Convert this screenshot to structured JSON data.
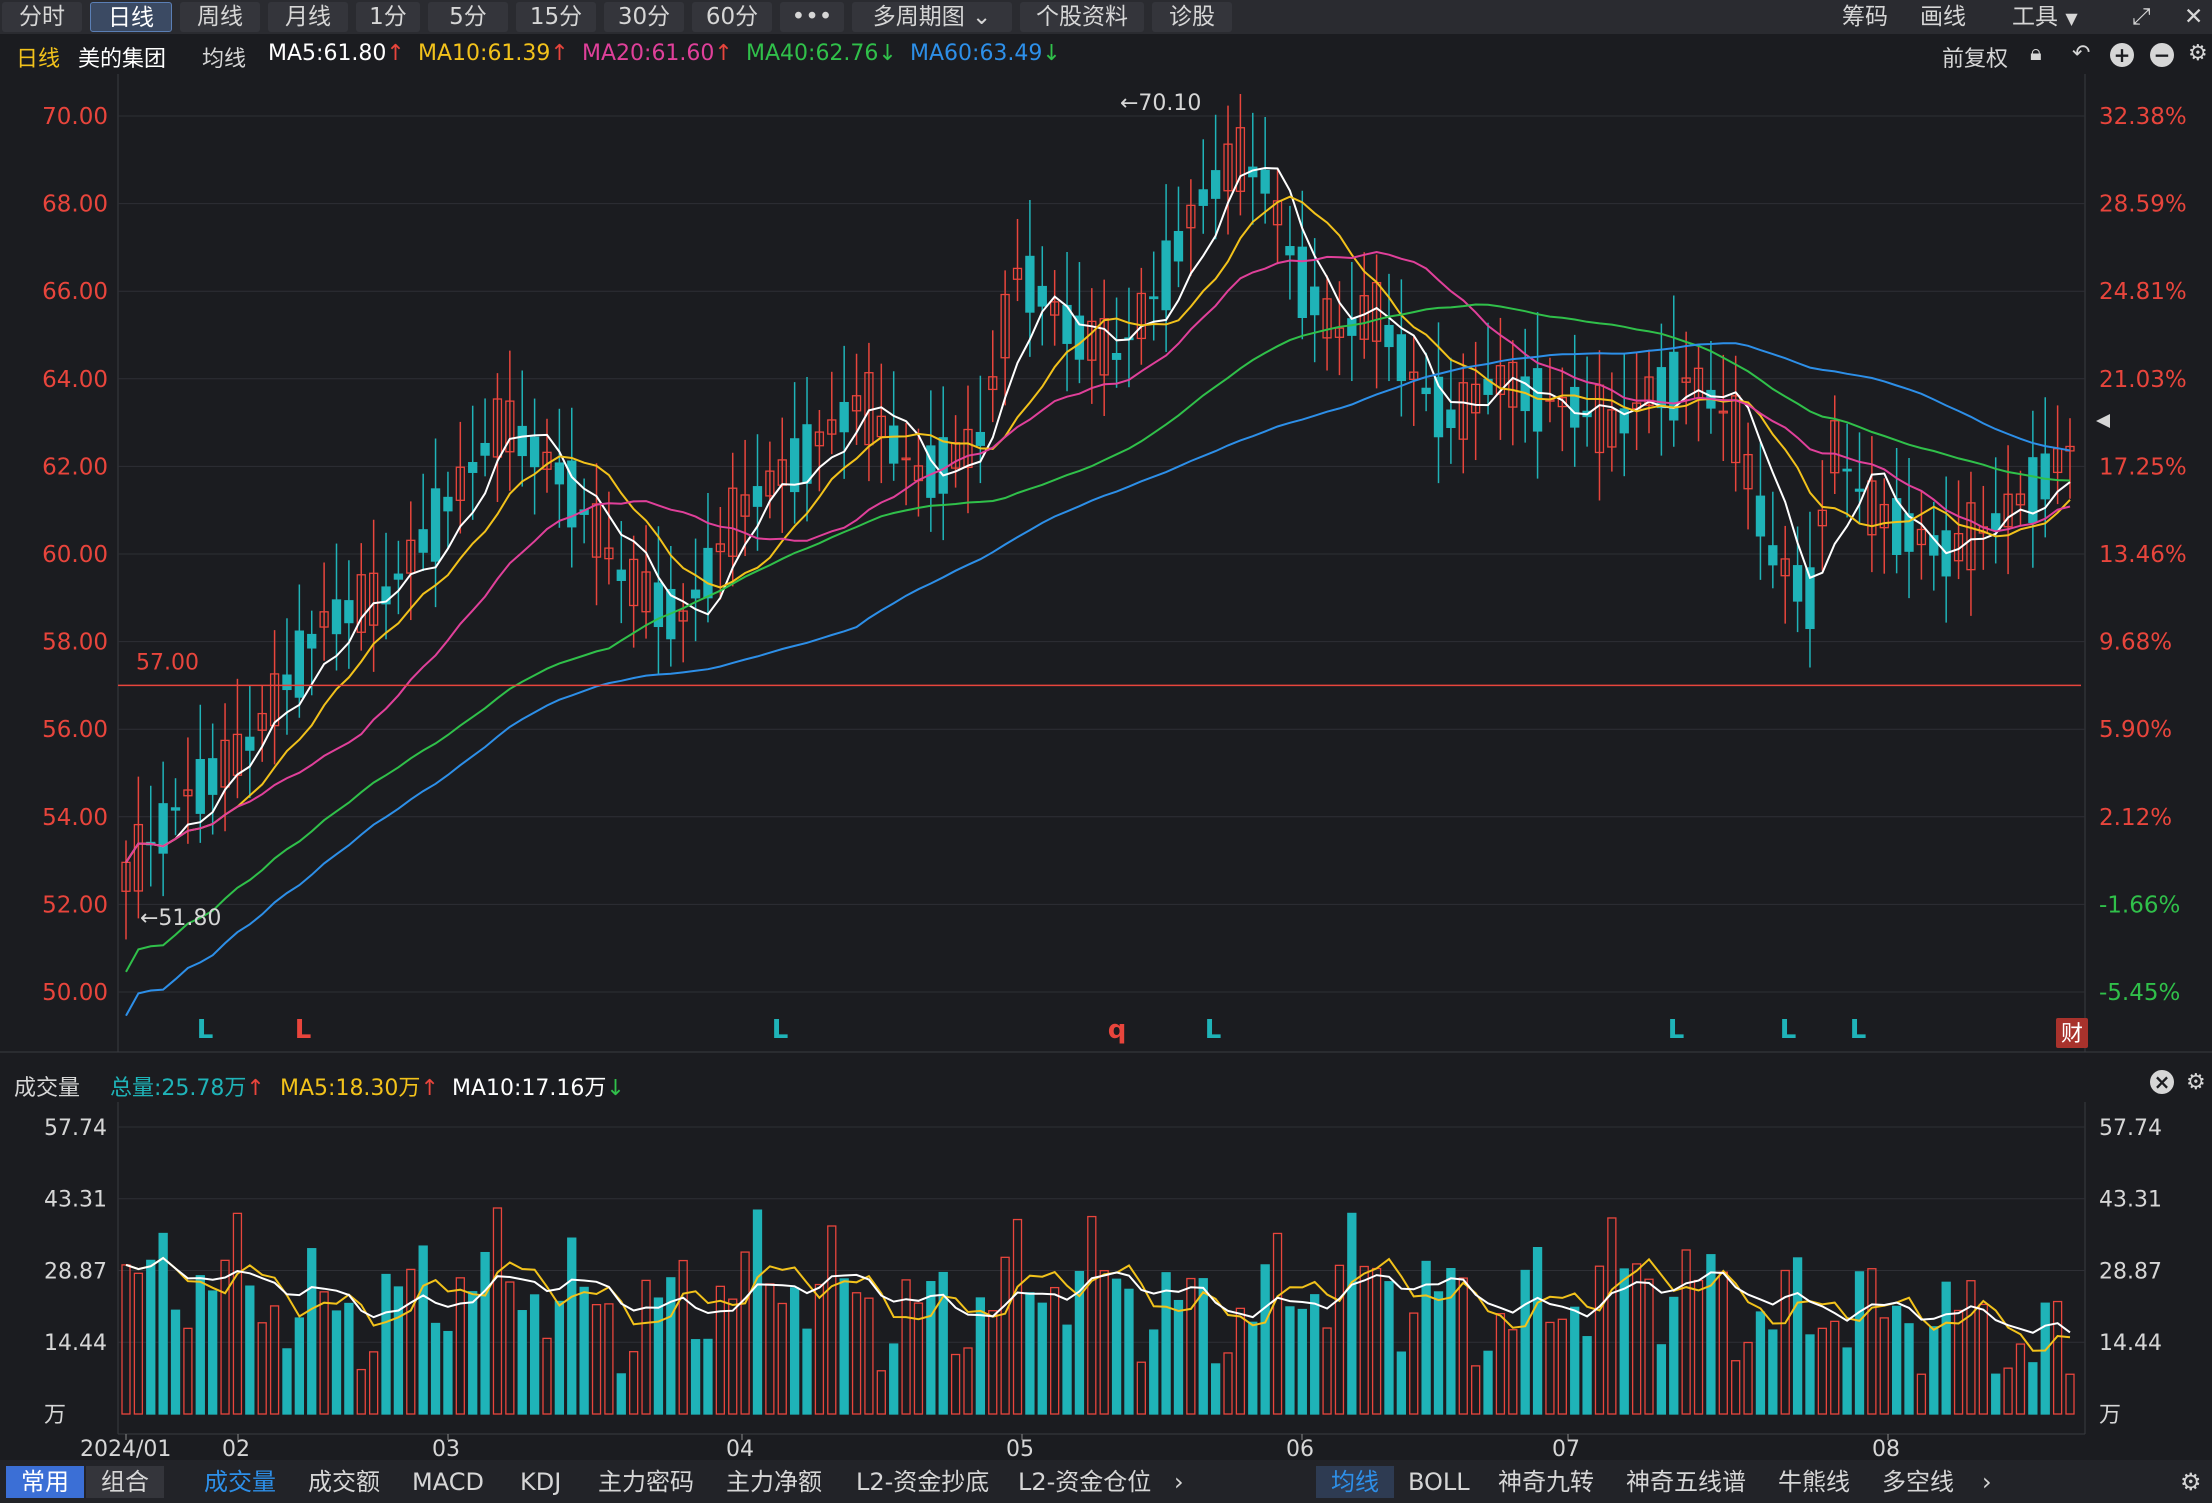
{
  "toolbar": {
    "period_tabs": [
      "分时",
      "日线",
      "周线",
      "月线",
      "1分",
      "5分",
      "15分",
      "30分",
      "60分"
    ],
    "more_label": "•••",
    "multi_period_label": "多周期图",
    "stock_info_label": "个股资料",
    "diagnose_label": "诊股",
    "chips_label": "筹码",
    "draw_label": "画线",
    "tools_label": "工具"
  },
  "info": {
    "period": "日线",
    "stock_name": "美的集团",
    "ma_label": "均线",
    "ma5": "MA5:61.80",
    "ma10": "MA10:61.39",
    "ma20": "MA20:61.60",
    "ma40": "MA40:62.76",
    "ma60": "MA60:63.49",
    "adjust_label": "前复权"
  },
  "colors": {
    "up": "#e8453c",
    "down": "#1fb3b8",
    "ma5": "#ffffff",
    "ma10": "#f2c21b",
    "ma20": "#e0409a",
    "ma40": "#30c04a",
    "ma60": "#2d8fe8"
  },
  "chart_data": [
    {
      "type": "candlestick",
      "title": "美的集团 日线",
      "y_ticks_left": [
        "70.00",
        "68.00",
        "66.00",
        "64.00",
        "62.00",
        "60.00",
        "58.00",
        "56.00",
        "54.00",
        "52.00",
        "50.00"
      ],
      "y_ticks_right": [
        "32.38%",
        "28.59%",
        "24.81%",
        "21.03%",
        "17.25%",
        "13.46%",
        "9.68%",
        "5.90%",
        "2.12%",
        "-1.66%",
        "-5.45%"
      ],
      "ylim": [
        49.6,
        70.6
      ],
      "x_ticks": [
        "2024/01",
        "02",
        "03",
        "04",
        "05",
        "06",
        "07",
        "08"
      ],
      "annotations": {
        "high": "←70.10",
        "low": "←51.80",
        "hline": "57.00",
        "hline_value": 57.0
      },
      "markers": [
        "L",
        "L",
        "L",
        "q",
        "L",
        "L",
        "L",
        "L"
      ],
      "finance_badge": "财",
      "ma_values": {
        "MA5": 61.8,
        "MA10": 61.39,
        "MA20": 61.6,
        "MA40": 62.76,
        "MA60": 63.49
      }
    },
    {
      "type": "bar",
      "title": "成交量",
      "total": "总量:25.78万",
      "ma5": "MA5:18.30万",
      "ma10": "MA10:17.16万",
      "y_ticks": [
        "57.74",
        "43.31",
        "28.87",
        "14.44",
        "万"
      ],
      "ylim": [
        0,
        57.74
      ],
      "unit": "万"
    }
  ],
  "volume": {
    "panel_label": "成交量",
    "total": "总量:25.78万",
    "ma5": "MA5:18.30万",
    "ma10": "MA10:17.16万"
  },
  "bottom": {
    "left_tabs": [
      "常用",
      "组合"
    ],
    "indicator_tabs": [
      "成交量",
      "成交额",
      "MACD",
      "KDJ",
      "主力密码",
      "主力净额",
      "L2-资金抄底",
      "L2-资金仓位"
    ],
    "overlay_tabs": [
      "均线",
      "BOLL",
      "神奇九转",
      "神奇五线谱",
      "牛熊线",
      "多空线"
    ]
  }
}
